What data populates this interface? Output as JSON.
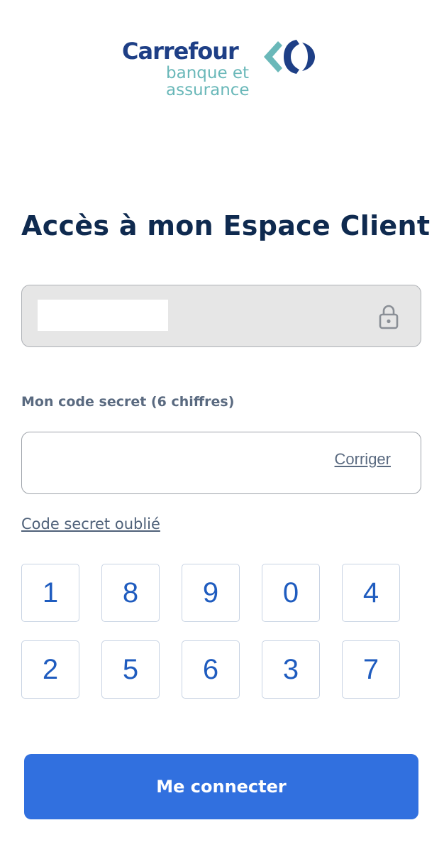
{
  "logo": {
    "brand": "Carrefour",
    "sub_line1": "banque et",
    "sub_line2": "assurance",
    "colors": {
      "brand": "#1e3f86",
      "sub": "#6ab8b9"
    }
  },
  "page_title": "Accès à mon Espace Client",
  "identifier_field": {
    "icon": "lock-icon",
    "locked": true
  },
  "code": {
    "label": "Mon code secret (6 chiffres)",
    "value": "",
    "correct_label": "Corriger"
  },
  "forgot_link": "Code secret oublié",
  "keypad": {
    "rows": [
      [
        "1",
        "8",
        "9",
        "0",
        "4"
      ],
      [
        "2",
        "5",
        "6",
        "3",
        "7"
      ]
    ]
  },
  "connect_button": "Me connecter",
  "colors": {
    "accent": "#3170df",
    "title": "#0f2a4f",
    "key_digit": "#1f5cbf"
  }
}
